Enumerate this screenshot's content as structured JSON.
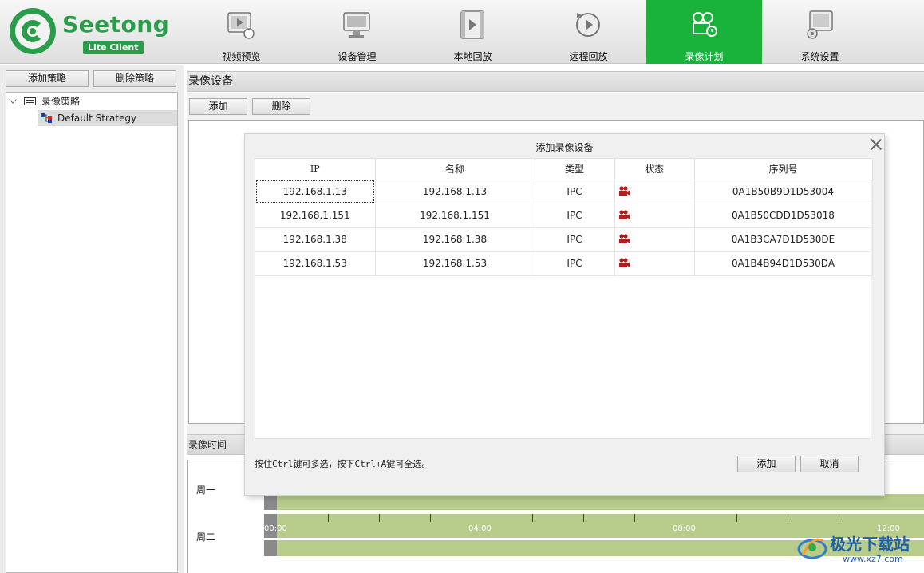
{
  "app": {
    "logo_text": "Seetong",
    "logo_badge": "Lite Client",
    "accent_color": "#19b23a",
    "brand_color": "#2a9d4a"
  },
  "nav": {
    "items": [
      {
        "label": "视频预览",
        "icon": "video-preview-icon"
      },
      {
        "label": "设备管理",
        "icon": "device-management-icon"
      },
      {
        "label": "本地回放",
        "icon": "local-playback-icon"
      },
      {
        "label": "远程回放",
        "icon": "remote-playback-icon"
      },
      {
        "label": "录像计划",
        "icon": "recording-plan-icon",
        "active": true
      },
      {
        "label": "系统设置",
        "icon": "system-settings-icon"
      }
    ]
  },
  "sidebar": {
    "add_label": "添加策略",
    "delete_label": "删除策略",
    "tree": {
      "root_label": "录像策略",
      "child_label": "Default Strategy"
    }
  },
  "record_devices": {
    "title": "录像设备",
    "add_label": "添加",
    "delete_label": "删除"
  },
  "record_time": {
    "title": "录像时间",
    "days": [
      "周一",
      "周二"
    ],
    "ticks": [
      "00:00",
      "04:00",
      "08:00",
      "12:00"
    ],
    "partial_tick_row1": "2:00"
  },
  "dialog": {
    "title": "添加录像设备",
    "columns": [
      "IP",
      "名称",
      "类型",
      "状态",
      "序列号"
    ],
    "rows": [
      {
        "ip": "192.168.1.13",
        "name": "192.168.1.13",
        "type": "IPC",
        "status_icon": "camera-status-icon",
        "serial": "0A1B50B9D1D53004"
      },
      {
        "ip": "192.168.1.151",
        "name": "192.168.1.151",
        "type": "IPC",
        "status_icon": "camera-status-icon",
        "serial": "0A1B50CDD1D53018"
      },
      {
        "ip": "192.168.1.38",
        "name": "192.168.1.38",
        "type": "IPC",
        "status_icon": "camera-status-icon",
        "serial": "0A1B3CA7D1D530DE"
      },
      {
        "ip": "192.168.1.53",
        "name": "192.168.1.53",
        "type": "IPC",
        "status_icon": "camera-status-icon",
        "serial": "0A1B4B94D1D530DA"
      }
    ],
    "hint": "按住Ctrl键可多选，按下Ctrl+A键可全选。",
    "add_label": "添加",
    "cancel_label": "取消"
  },
  "watermark": {
    "text": "极光下载站",
    "url": "www.xz7.com"
  }
}
